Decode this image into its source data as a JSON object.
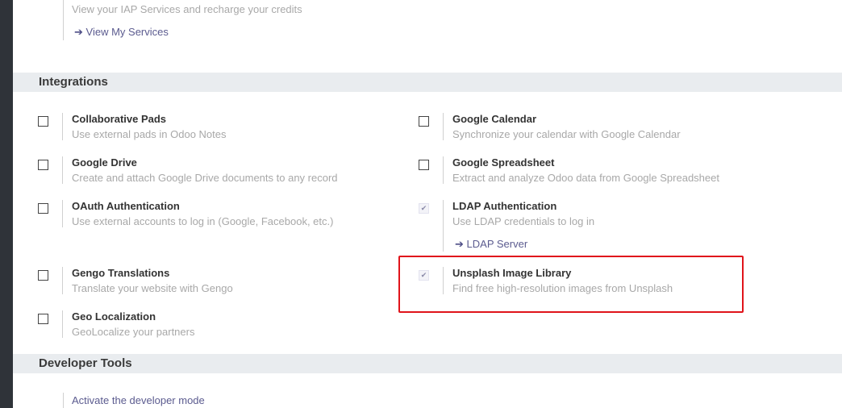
{
  "iap": {
    "description": "View your IAP Services and recharge your credits",
    "link_arrow": "➔",
    "link_label": "View My Services"
  },
  "integrations": {
    "header": "Integrations",
    "collaborative_pads": {
      "title": "Collaborative Pads",
      "desc": "Use external pads in Odoo Notes",
      "checked": false
    },
    "google_calendar": {
      "title": "Google Calendar",
      "desc": "Synchronize your calendar with Google Calendar",
      "checked": false
    },
    "google_drive": {
      "title": "Google Drive",
      "desc": "Create and attach Google Drive documents to any record",
      "checked": false
    },
    "google_spreadsheet": {
      "title": "Google Spreadsheet",
      "desc": "Extract and analyze Odoo data from Google Spreadsheet",
      "checked": false
    },
    "oauth": {
      "title": "OAuth Authentication",
      "desc": "Use external accounts to log in (Google, Facebook, etc.)",
      "checked": false
    },
    "ldap": {
      "title": "LDAP Authentication",
      "desc": "Use LDAP credentials to log in",
      "checked": true,
      "check_mark": "✔",
      "link_arrow": "➔",
      "link_label": "LDAP Server"
    },
    "gengo": {
      "title": "Gengo Translations",
      "desc": "Translate your website with Gengo",
      "checked": false
    },
    "unsplash": {
      "title": "Unsplash Image Library",
      "desc": "Find free high-resolution images from Unsplash",
      "checked": true,
      "check_mark": "✔"
    },
    "geo": {
      "title": "Geo Localization",
      "desc": "GeoLocalize your partners",
      "checked": false
    }
  },
  "developer_tools": {
    "header": "Developer Tools",
    "activate_label": "Activate the developer mode"
  },
  "colors": {
    "highlight": "#e0141b",
    "link": "#5b5b8f",
    "section_bg": "#e9ecef"
  }
}
